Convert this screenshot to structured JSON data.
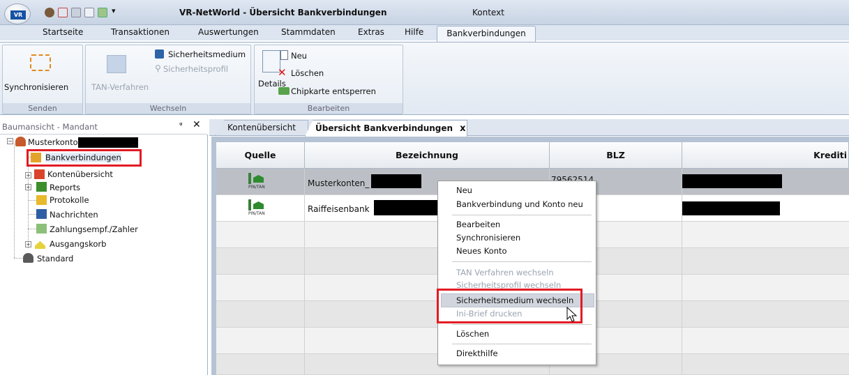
{
  "window": {
    "title": "VR-NetWorld - Übersicht Bankverbindungen",
    "context": "Kontext"
  },
  "ribbon_tabs": [
    "Startseite",
    "Transaktionen",
    "Auswertungen",
    "Stammdaten",
    "Extras",
    "Hilfe",
    "Bankverbindungen"
  ],
  "ribbon": {
    "senden": {
      "label": "Senden",
      "sync": "Synchronisieren"
    },
    "wechseln": {
      "label": "Wechseln",
      "tan": "TAN-Verfahren",
      "medium": "Sicherheitsmedium",
      "profil": "Sicherheitsprofil"
    },
    "bearbeiten": {
      "label": "Bearbeiten",
      "details": "Details",
      "neu": "Neu",
      "loeschen": "Löschen",
      "chipkarte": "Chipkarte entsperren"
    }
  },
  "pane": {
    "title": "Baumansicht - Mandant",
    "pin": "ᵠ",
    "close": "✕"
  },
  "tree": [
    "Musterkonto",
    "Bankverbindungen",
    "Kontenübersicht",
    "Reports",
    "Protokolle",
    "Nachrichten",
    "Zahlungsempf./Zahler",
    "Ausgangskorb",
    "Standard"
  ],
  "doc_tabs": {
    "tab1": "Kontenübersicht",
    "tab2": "Übersicht Bankverbindungen",
    "close": "x"
  },
  "table": {
    "columns": [
      "Quelle",
      "Bezeichnung",
      "BLZ",
      "Krediti"
    ],
    "rows": [
      {
        "quelle": "PIN/TAN",
        "bezeichnung": "Musterkonten_",
        "blz": "79562514"
      },
      {
        "quelle": "PIN/TAN",
        "bezeichnung": "Raiffeisenbank",
        "blz": ""
      }
    ]
  },
  "context_menu": {
    "items": [
      "Neu",
      "Bankverbindung und Konto neu",
      "Bearbeiten",
      "Synchronisieren",
      "Neues Konto",
      "TAN Verfahren wechseln",
      "Sicherheitsprofil wechseln",
      "Sicherheitsmedium wechseln",
      "Ini-Brief drucken",
      "Löschen",
      "Direkthilfe"
    ]
  }
}
